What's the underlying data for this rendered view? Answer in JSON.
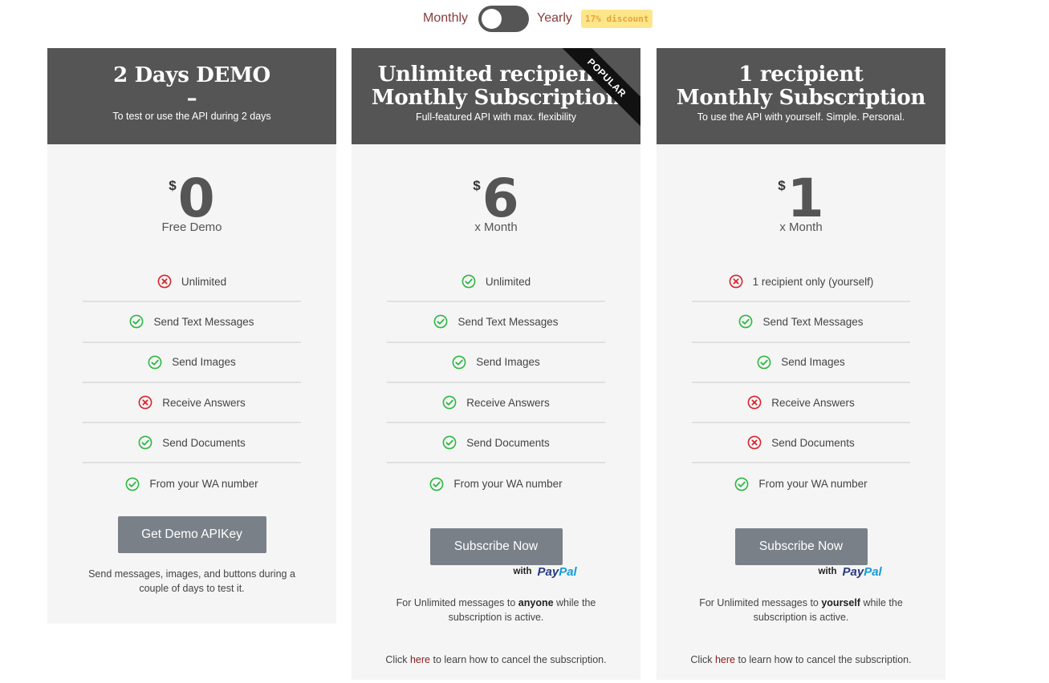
{
  "billing": {
    "monthly_label": "Monthly",
    "yearly_label": "Yearly",
    "discount_badge": "17% discount",
    "selected": "Monthly"
  },
  "colors": {
    "header_bg": "#555555",
    "card_bg": "#f5f5f5",
    "check": "#2db742",
    "cross": "#d9232d",
    "button": "#7a8088",
    "label_red": "#8a3b3b"
  },
  "plans": [
    {
      "title_line1": "2 Days DEMO",
      "title_line2": "–",
      "subtitle": "To test or use the API during 2 days",
      "currency": "$",
      "price": "0",
      "period": "Free Demo",
      "features": [
        {
          "label": "Unlimited",
          "ok": false,
          "icon": "cross-circle-icon"
        },
        {
          "label": "Send Text Messages",
          "ok": true,
          "icon": "check-circle-icon"
        },
        {
          "label": "Send Images",
          "ok": true,
          "icon": "check-circle-icon"
        },
        {
          "label": "Receive Answers",
          "ok": false,
          "icon": "cross-circle-icon"
        },
        {
          "label": "Send Documents",
          "ok": true,
          "icon": "check-circle-icon"
        },
        {
          "label": "From your WA number",
          "ok": true,
          "icon": "check-circle-icon"
        }
      ],
      "button": "Get Demo APIKey",
      "note": "Send messages, images, and buttons during a couple of days to test it."
    },
    {
      "title_line1": "Unlimited recipients",
      "title_line2": "Monthly Subscription",
      "subtitle": "Full-featured API with max. flexibility",
      "ribbon": "POPULAR",
      "currency": "$",
      "price": "6",
      "period": "x Month",
      "features": [
        {
          "label": "Unlimited",
          "ok": true,
          "icon": "check-circle-icon"
        },
        {
          "label": "Send Text Messages",
          "ok": true,
          "icon": "check-circle-icon"
        },
        {
          "label": "Send Images",
          "ok": true,
          "icon": "check-circle-icon"
        },
        {
          "label": "Receive Answers",
          "ok": true,
          "icon": "check-circle-icon"
        },
        {
          "label": "Send Documents",
          "ok": true,
          "icon": "check-circle-icon"
        },
        {
          "label": "From your WA number",
          "ok": true,
          "icon": "check-circle-icon"
        }
      ],
      "button": "Subscribe Now",
      "paypal_with": "with",
      "paypal_brand_1": "Pay",
      "paypal_brand_2": "Pal",
      "note_pre": "For Unlimited messages to ",
      "note_bold": "anyone",
      "note_post": " while the subscription is active.",
      "cancel_pre": "Click ",
      "cancel_link": "here",
      "cancel_post": " to learn how to cancel the subscription."
    },
    {
      "title_line1": "1 recipient",
      "title_line2": "Monthly Subscription",
      "subtitle": "To use the API with yourself. Simple. Personal.",
      "currency": "$",
      "price": "1",
      "period": "x Month",
      "features": [
        {
          "label": "1 recipient only (yourself)",
          "ok": false,
          "icon": "cross-circle-icon"
        },
        {
          "label": "Send Text Messages",
          "ok": true,
          "icon": "check-circle-icon"
        },
        {
          "label": "Send Images",
          "ok": true,
          "icon": "check-circle-icon"
        },
        {
          "label": "Receive Answers",
          "ok": false,
          "icon": "cross-circle-icon"
        },
        {
          "label": "Send Documents",
          "ok": false,
          "icon": "cross-circle-icon"
        },
        {
          "label": "From your WA number",
          "ok": true,
          "icon": "check-circle-icon"
        }
      ],
      "button": "Subscribe Now",
      "paypal_with": "with",
      "paypal_brand_1": "Pay",
      "paypal_brand_2": "Pal",
      "note_pre": "For Unlimited messages to ",
      "note_bold": "yourself",
      "note_post": " while the subscription is active.",
      "cancel_pre": "Click ",
      "cancel_link": "here",
      "cancel_post": " to learn how to cancel the subscription."
    }
  ]
}
